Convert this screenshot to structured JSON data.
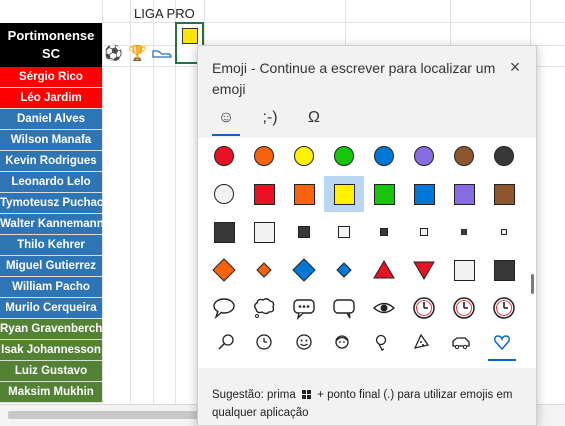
{
  "sheet": {
    "header_label": "LIGA PRO",
    "team": "Portimonense SC",
    "players": [
      {
        "name": "Sérgio Rico",
        "group": "red"
      },
      {
        "name": "Léo Jardim",
        "group": "red"
      },
      {
        "name": "Daniel Alves",
        "group": "blue"
      },
      {
        "name": "Wilson Manafa",
        "group": "blue"
      },
      {
        "name": "Kevin Rodrigues",
        "group": "blue"
      },
      {
        "name": "Leonardo Lelo",
        "group": "blue"
      },
      {
        "name": "Tymoteusz Puchacz",
        "group": "blue"
      },
      {
        "name": "Walter Kannemann",
        "group": "blue"
      },
      {
        "name": "Thilo Kehrer",
        "group": "blue"
      },
      {
        "name": "Miguel Gutierrez",
        "group": "blue"
      },
      {
        "name": "William Pacho",
        "group": "blue"
      },
      {
        "name": "Murilo Cerqueira",
        "group": "blue"
      },
      {
        "name": "Ryan Gravenberch",
        "group": "green"
      },
      {
        "name": "Isak Johannesson",
        "group": "green"
      },
      {
        "name": "Luiz Gustavo",
        "group": "green"
      },
      {
        "name": "Maksim Mukhin",
        "group": "green"
      }
    ],
    "row_icons": [
      "soccer-ball-icon",
      "trophy-icon",
      "sneaker-icon"
    ],
    "selected_cell_content": "yellow-square"
  },
  "emoji_panel": {
    "title": "Emoji - Continue a escrever para localizar um emoji",
    "close_label": "×",
    "tabs": [
      {
        "label": "☺",
        "name": "tab-emoji",
        "active": true
      },
      {
        "label": ";-)",
        "name": "tab-kaomoji",
        "active": false
      },
      {
        "label": "Ω",
        "name": "tab-symbols",
        "active": false
      }
    ],
    "rows": [
      [
        "red-circle",
        "orange-circle",
        "yellow-circle",
        "green-circle",
        "blue-circle",
        "purple-circle",
        "brown-circle",
        "black-circle"
      ],
      [
        "white-circle",
        "red-square",
        "orange-square",
        "yellow-square",
        "green-square",
        "blue-square",
        "purple-square",
        "brown-square"
      ],
      [
        "black-large-square",
        "white-large-square",
        "black-medium-square",
        "white-medium-square",
        "black-small-square",
        "white-small-square",
        "black-tiny-square",
        "white-tiny-square"
      ],
      [
        "large-orange-diamond",
        "small-orange-diamond",
        "large-blue-diamond",
        "small-blue-diamond",
        "red-triangle-up",
        "red-triangle-down",
        "white-square-button",
        "black-square-button"
      ],
      [
        "speech-bubble",
        "thought-bubble",
        "speech-dots",
        "right-speech-bubble",
        "eye-in-bubble",
        "clock",
        "clock",
        "clock"
      ]
    ],
    "selected_emoji": "yellow-square",
    "categories": [
      {
        "name": "search-category",
        "glyph": "⚲"
      },
      {
        "name": "recent-category",
        "glyph": "◷"
      },
      {
        "name": "smileys-category",
        "glyph": "☺"
      },
      {
        "name": "people-category",
        "glyph": "☻"
      },
      {
        "name": "places-category",
        "glyph": "⚲"
      },
      {
        "name": "food-category",
        "glyph": "◔"
      },
      {
        "name": "transport-category",
        "glyph": "⛟"
      },
      {
        "name": "symbols-category",
        "glyph": "♡"
      }
    ],
    "active_category": "symbols-category",
    "suggestion_before": "Sugestão: prima",
    "suggestion_after": "+ ponto final (.) para utilizar emojis em qualquer aplicação"
  },
  "colors": {
    "accent": "#0a64c2",
    "selection_bg": "#b9d7f3",
    "red_group": "#fe0000",
    "blue_group": "#2e75b6",
    "green_group": "#548235"
  }
}
